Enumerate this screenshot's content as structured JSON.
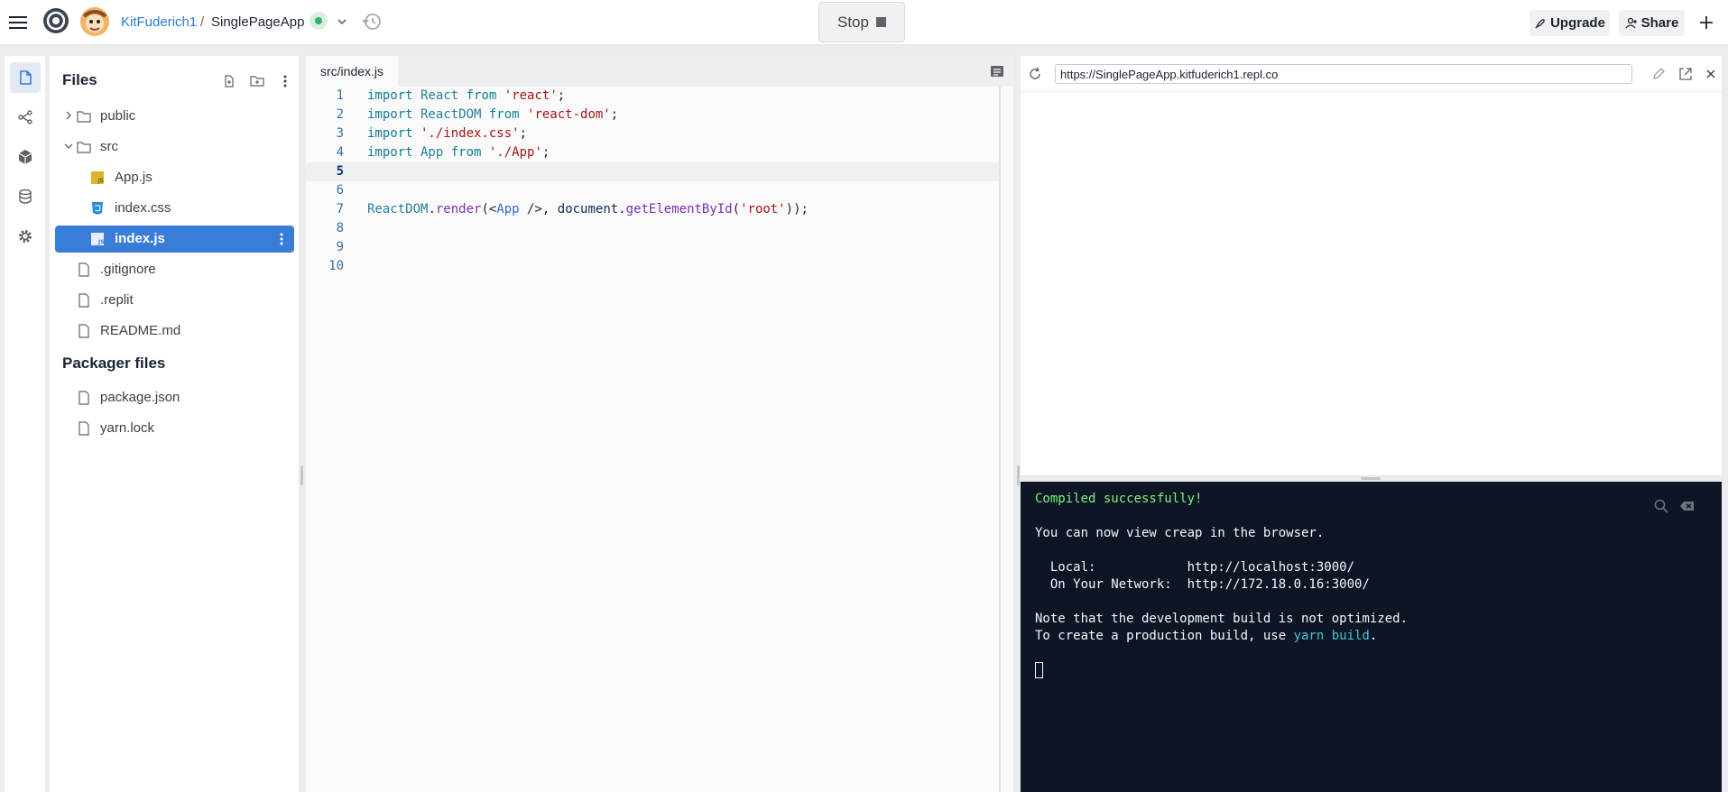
{
  "topbar": {
    "owner": "KitFuderich1",
    "separator": "/",
    "repl_name": "SinglePageApp",
    "stop_label": "Stop",
    "upgrade_label": "Upgrade",
    "share_label": "Share"
  },
  "files_panel": {
    "title": "Files",
    "tree": [
      {
        "label": "public",
        "type": "folder",
        "collapsed": true
      },
      {
        "label": "src",
        "type": "folder",
        "collapsed": false
      },
      {
        "label": "App.js",
        "type": "js"
      },
      {
        "label": "index.css",
        "type": "css"
      },
      {
        "label": "index.js",
        "type": "js",
        "selected": true
      },
      {
        "label": ".gitignore",
        "type": "file"
      },
      {
        "label": ".replit",
        "type": "file"
      },
      {
        "label": "README.md",
        "type": "file"
      }
    ],
    "packager_title": "Packager files",
    "packager": [
      {
        "label": "package.json"
      },
      {
        "label": "yarn.lock"
      }
    ]
  },
  "editor": {
    "tab_label": "src/index.js",
    "active_line": 5,
    "line_numbers": [
      "1",
      "2",
      "3",
      "4",
      "5",
      "6",
      "7",
      "8",
      "9",
      "10"
    ],
    "tokens": {
      "l1": [
        "import",
        " React ",
        "from",
        " 'react'",
        ";"
      ],
      "l2": [
        "import",
        " ReactDOM ",
        "from",
        " 'react-dom'",
        ";"
      ],
      "l3": [
        "import",
        " './index.css'",
        ";"
      ],
      "l4": [
        "import",
        " App ",
        "from",
        " './App'",
        ";"
      ],
      "l7": [
        "ReactDOM",
        ".",
        "render",
        "(<",
        "App",
        " />, ",
        "document",
        ".",
        "getElementById",
        "(",
        "'root'",
        "));"
      ]
    }
  },
  "webview": {
    "url": "https://SinglePageApp.kitfuderich1.repl.co"
  },
  "console": {
    "lines": {
      "compiled": "Compiled successfully!",
      "view": "You can now view creap in the browser.",
      "local": "  Local:            http://localhost:3000/",
      "network": "  On Your Network:  http://172.18.0.16:3000/",
      "note": "Note that the development build is not optimized.",
      "prod_prefix": "To create a production build, use ",
      "prod_cmd": "yarn build",
      "prod_suffix": "."
    }
  },
  "colors": {
    "accent": "#3a7dd8",
    "console_bg": "#0e1525",
    "console_success": "#7cf57c",
    "console_link": "#3fc6d6"
  }
}
